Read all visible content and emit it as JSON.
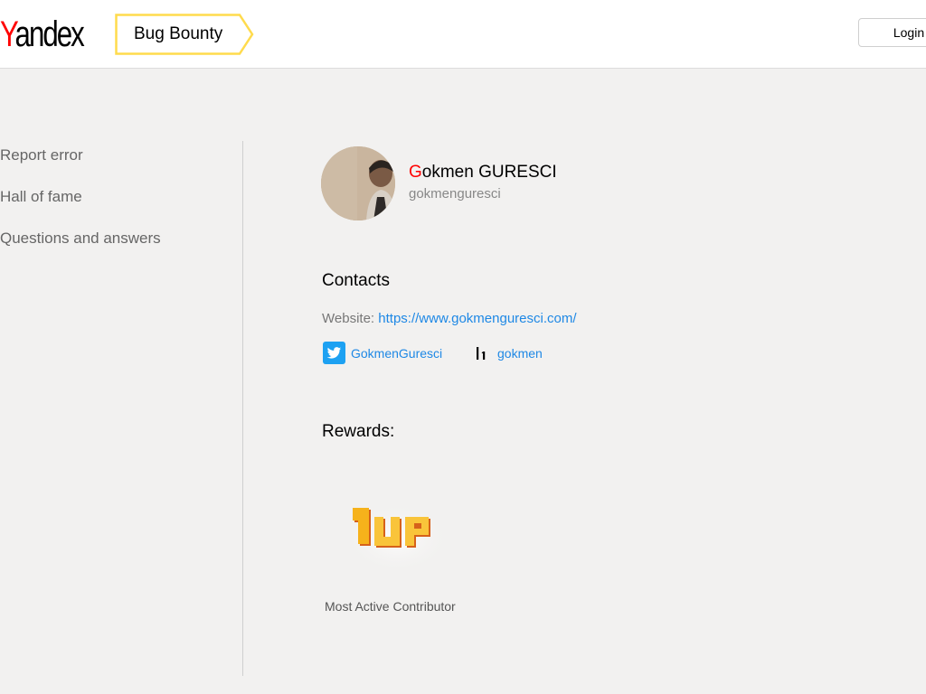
{
  "header": {
    "logo_first": "Y",
    "logo_rest": "andex",
    "section_title": "Bug Bounty",
    "login_label": "Login"
  },
  "sidebar": {
    "items": [
      {
        "label": "Report error"
      },
      {
        "label": "Hall of fame"
      },
      {
        "label": "Questions and answers"
      }
    ]
  },
  "profile": {
    "name_initial": "G",
    "name_rest": "okmen GURESCI",
    "handle": "gokmenguresci"
  },
  "contacts": {
    "title": "Contacts",
    "website_label": "Website:",
    "website_url": "https://www.gokmenguresci.com/",
    "twitter_handle": "GokmenGuresci",
    "twitter_icon": "twitter-icon",
    "hackerone_handle": "gokmen",
    "hackerone_icon": "hackerone-icon"
  },
  "rewards": {
    "title": "Rewards:",
    "badge_caption": "Most Active Contributor",
    "badge_icon": "1up-badge-icon"
  },
  "colors": {
    "brand_red": "#ff0000",
    "bug_bounty_border": "#ffdb4d",
    "link_blue": "#1e88e5",
    "twitter_blue": "#1da1f2",
    "page_bg": "#f2f1f0"
  }
}
